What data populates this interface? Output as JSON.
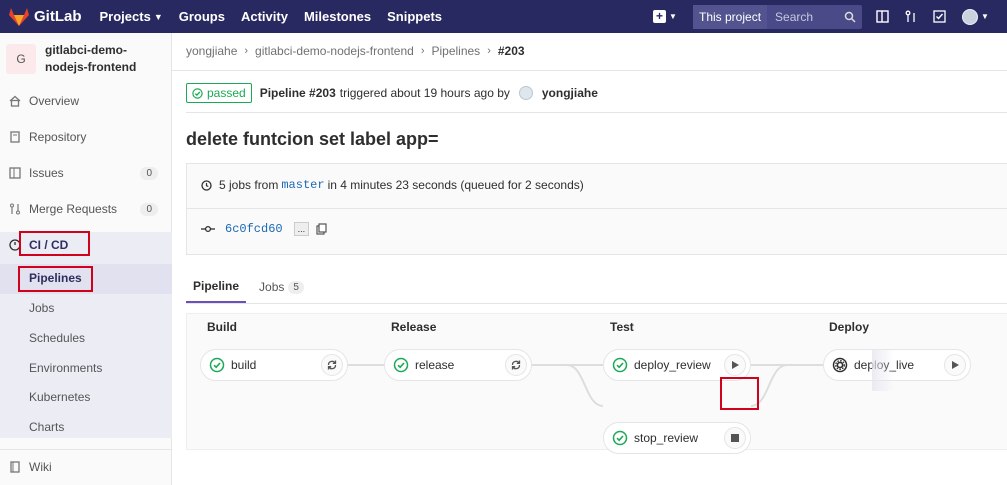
{
  "topbar": {
    "brand": "GitLab",
    "nav": [
      {
        "label": "Projects",
        "caret": true
      },
      {
        "label": "Groups"
      },
      {
        "label": "Activity"
      },
      {
        "label": "Milestones"
      },
      {
        "label": "Snippets"
      }
    ],
    "search_scope": "This project",
    "search_placeholder": "Search"
  },
  "sidebar": {
    "project_initial": "G",
    "project_name": "gitlabci-demo-nodejs-frontend",
    "items": [
      {
        "label": "Overview",
        "icon": "home-icon"
      },
      {
        "label": "Repository",
        "icon": "book-icon"
      },
      {
        "label": "Issues",
        "icon": "issues-icon",
        "badge": "0"
      },
      {
        "label": "Merge Requests",
        "icon": "merge-request-icon",
        "badge": "0"
      },
      {
        "label": "CI / CD",
        "icon": "rocket-icon"
      },
      {
        "label": "Wiki",
        "icon": "wiki-icon"
      }
    ],
    "cicd_sub": [
      "Pipelines",
      "Jobs",
      "Schedules",
      "Environments",
      "Kubernetes",
      "Charts"
    ]
  },
  "breadcrumb": [
    "yongjiahe",
    "gitlabci-demo-nodejs-frontend",
    "Pipelines",
    "#203"
  ],
  "pipeline": {
    "status": "passed",
    "label": "Pipeline #203",
    "triggered_text": "triggered about 19 hours ago by",
    "user": "yongjiahe",
    "title": "delete funtcion set label app=",
    "jobs_prefix": "5 jobs from",
    "branch": "master",
    "duration_text": "in 4 minutes 23 seconds (queued for 2 seconds)",
    "commit": "6c0fcd60",
    "commit_ellipsis": "..."
  },
  "tabs": [
    {
      "label": "Pipeline",
      "active": true
    },
    {
      "label": "Jobs",
      "count": "5"
    }
  ],
  "stages": [
    {
      "name": "Build",
      "jobs": [
        {
          "name": "build",
          "action": "retry",
          "status": "success"
        }
      ]
    },
    {
      "name": "Release",
      "jobs": [
        {
          "name": "release",
          "action": "retry",
          "status": "success"
        }
      ]
    },
    {
      "name": "Test",
      "jobs": [
        {
          "name": "deploy_review",
          "action": "play",
          "status": "success"
        },
        {
          "name": "stop_review",
          "action": "stop",
          "status": "success"
        }
      ]
    },
    {
      "name": "Deploy",
      "jobs": [
        {
          "name": "deploy_live",
          "action": "play",
          "status": "manual"
        }
      ]
    }
  ],
  "colors": {
    "topbar": "#292961",
    "success": "#1aaa55",
    "link": "#1b69b6",
    "active_tab": "#6b4fbb",
    "highlight": "#d0021b"
  }
}
